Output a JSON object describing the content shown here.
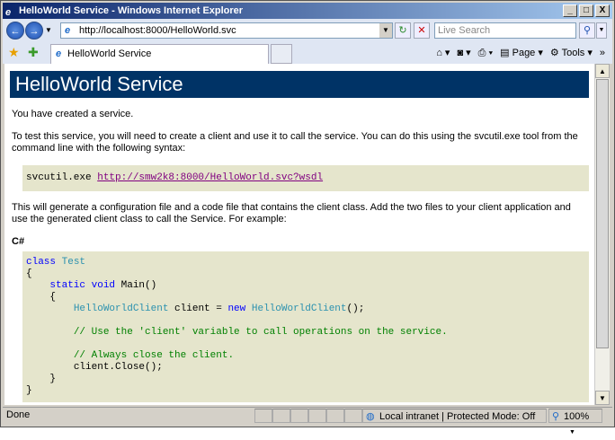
{
  "window": {
    "title": "HelloWorld Service - Windows Internet Explorer",
    "min": "_",
    "max": "□",
    "close": "X"
  },
  "address": {
    "url": "http://localhost:8000/HelloWorld.svc",
    "search_placeholder": "Live Search"
  },
  "tab": {
    "label": "HelloWorld Service"
  },
  "toolbar": {
    "page": "Page",
    "tools": "Tools"
  },
  "page": {
    "heading": "HelloWorld Service",
    "p1": "You have created a service.",
    "p2": "To test this service, you will need to create a client and use it to call the service. You can do this using the svcutil.exe tool from the command line with the following syntax:",
    "svcutil_cmd": "svcutil.exe ",
    "svcutil_link": "http://smw2k8:8000/HelloWorld.svc?wsdl",
    "p3": "This will generate a configuration file and a code file that contains the client class. Add the two files to your client application and use the generated client class to call the Service. For example:",
    "lang": "C#",
    "code": {
      "l1a": "class",
      "l1b": "Test",
      "l2": "{",
      "l3a": "static void",
      "l3b": " Main()",
      "l4": "{",
      "l5a": "HelloWorldClient",
      "l5b": " client = ",
      "l5c": "new",
      "l5d": "HelloWorldClient",
      "l5e": "();",
      "l6": "// Use the 'client' variable to call operations on the service.",
      "l7": "// Always close the client.",
      "l8": "client.Close();",
      "l9": "}",
      "l10": "}"
    }
  },
  "status": {
    "text": "Done",
    "zone": "Local intranet | Protected Mode: Off",
    "zoom": "100%"
  }
}
